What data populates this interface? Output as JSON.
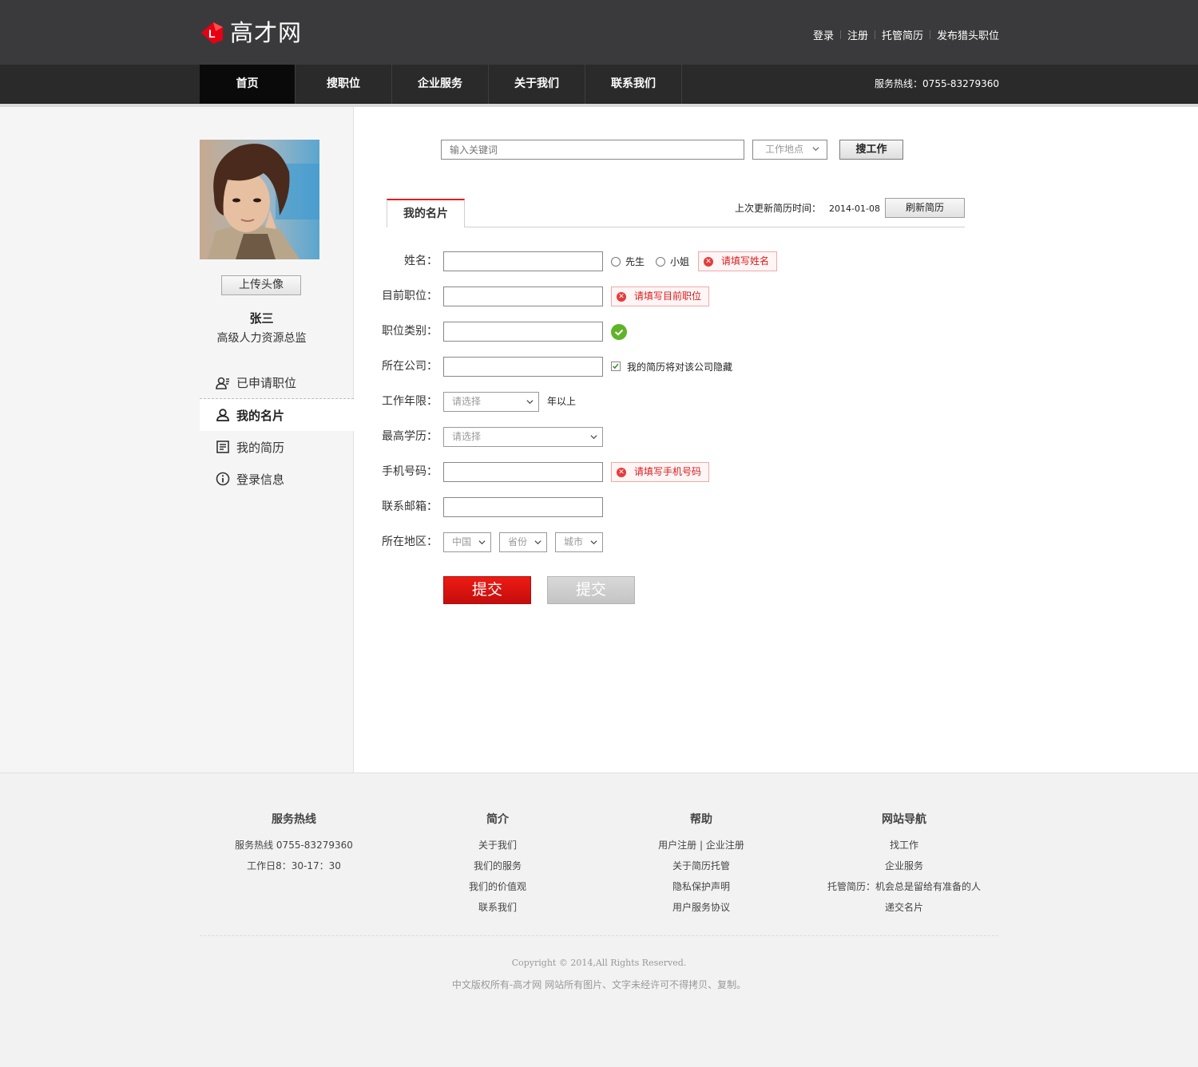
{
  "header": {
    "logo_text": "高才网",
    "links": [
      "登录",
      "注册",
      "托管简历",
      "发布猎头职位"
    ]
  },
  "nav": {
    "items": [
      "首页",
      "搜职位",
      "企业服务",
      "关于我们",
      "联系我们"
    ],
    "active": "首页",
    "hotline": "服务热线：0755-83279360"
  },
  "sidebar": {
    "upload_label": "上传头像",
    "name": "张三",
    "title": "高级人力资源总监",
    "menu": [
      "已申请职位",
      "我的名片",
      "我的简历",
      "登录信息"
    ],
    "active": "我的名片"
  },
  "search": {
    "keyword_placeholder": "输入关键词",
    "location": "工作地点",
    "button": "搜工作"
  },
  "card": {
    "tab": "我的名片",
    "last_update_label": "上次更新简历时间：",
    "last_update_date": "2014-01-08",
    "refresh_label": "刷新简历"
  },
  "form": {
    "name_label": "姓名：",
    "gender_options": [
      "先生",
      "小姐"
    ],
    "name_error": "请填写姓名",
    "position_label": "目前职位：",
    "position_error": "请填写目前职位",
    "category_label": "职位类别：",
    "company_label": "所在公司：",
    "company_hide_label": "我的简历将对该公司隐藏",
    "years_label": "工作年限：",
    "years_value": "请选择",
    "years_suffix": "年以上",
    "education_label": "最高学历：",
    "education_value": "请选择",
    "mobile_label": "手机号码：",
    "mobile_error": "请填写手机号码",
    "email_label": "联系邮箱：",
    "region_label": "所在地区：",
    "country": "中国",
    "province": "省份",
    "city": "城市",
    "submit_label": "提交",
    "submit2_label": "提交",
    "colors": {
      "error": "#d91c1c",
      "accent": "#e41d1d",
      "ok": "#5fb428"
    }
  },
  "footer": {
    "columns": [
      {
        "title": "服务热线",
        "items": [
          "服务热线 0755-83279360",
          "工作日8：30-17：30"
        ]
      },
      {
        "title": "简介",
        "items": [
          "关于我们",
          "我们的服务",
          "我们的价值观",
          "联系我们"
        ]
      },
      {
        "title": "帮助",
        "items": [
          "用户注册 | 企业注册",
          "关于简历托管",
          "隐私保护声明",
          "用户服务协议"
        ]
      },
      {
        "title": "网站导航",
        "items": [
          "找工作",
          "企业服务",
          "托管简历：机会总是留给有准备的人",
          "递交名片"
        ]
      }
    ],
    "copyright": "Copyright © 2014,All Rights Reserved.",
    "notice": "中文版权所有-高才网 网站所有图片、文字未经许可不得拷贝、复制。"
  }
}
